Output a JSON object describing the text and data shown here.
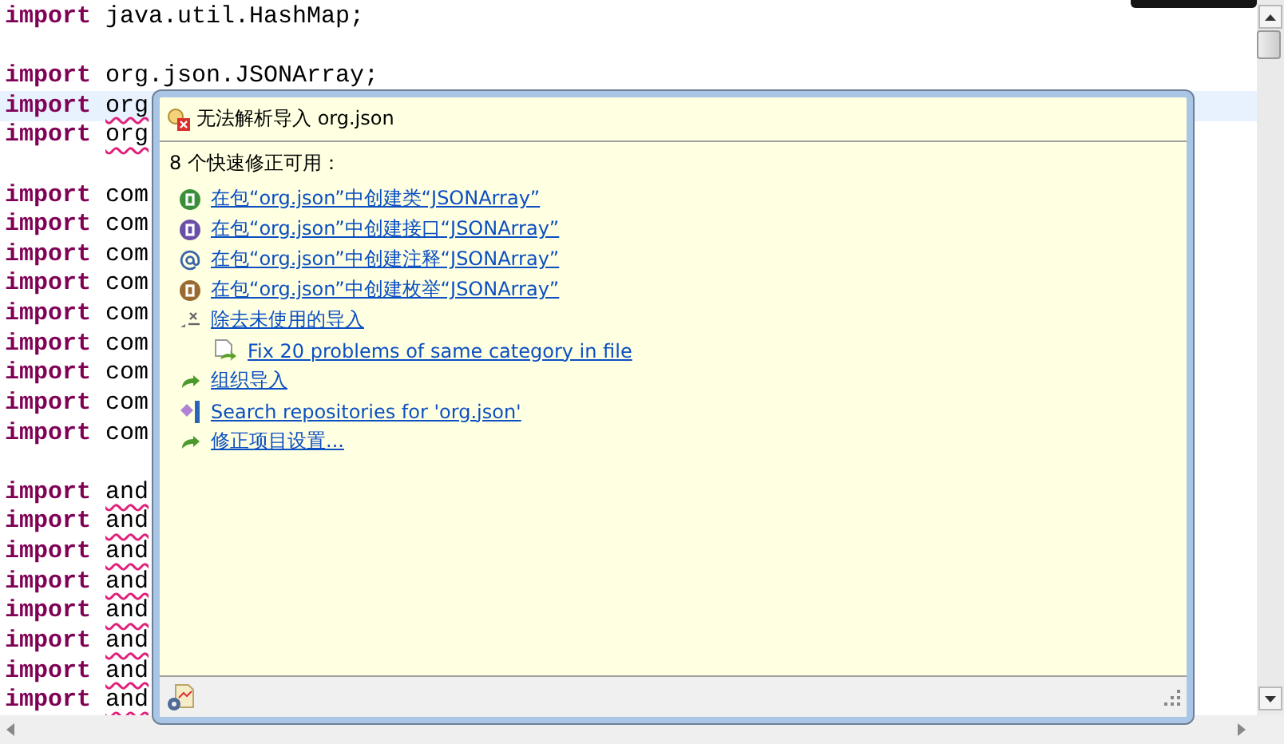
{
  "editor": {
    "lines": [
      {
        "kind": "import",
        "keyword": "import",
        "text": "java.util.HashMap;",
        "error": false,
        "current": false
      },
      {
        "kind": "blank"
      },
      {
        "kind": "import",
        "keyword": "import",
        "text": "org.json.JSONArray;",
        "error": false,
        "current": false
      },
      {
        "kind": "import",
        "keyword": "import",
        "text": "org",
        "error": true,
        "current": true
      },
      {
        "kind": "import",
        "keyword": "import",
        "text": "org",
        "error": true,
        "current": false
      },
      {
        "kind": "blank"
      },
      {
        "kind": "import",
        "keyword": "import",
        "text": "com",
        "error": false,
        "current": false
      },
      {
        "kind": "import",
        "keyword": "import",
        "text": "com",
        "error": false,
        "current": false
      },
      {
        "kind": "import",
        "keyword": "import",
        "text": "com",
        "error": false,
        "current": false
      },
      {
        "kind": "import",
        "keyword": "import",
        "text": "com",
        "error": false,
        "current": false
      },
      {
        "kind": "import",
        "keyword": "import",
        "text": "com",
        "error": false,
        "current": false
      },
      {
        "kind": "import",
        "keyword": "import",
        "text": "com",
        "error": false,
        "current": false
      },
      {
        "kind": "import",
        "keyword": "import",
        "text": "com",
        "error": false,
        "current": false
      },
      {
        "kind": "import",
        "keyword": "import",
        "text": "com",
        "error": false,
        "current": false
      },
      {
        "kind": "import",
        "keyword": "import",
        "text": "com",
        "error": false,
        "current": false
      },
      {
        "kind": "blank"
      },
      {
        "kind": "import",
        "keyword": "import",
        "text": "and",
        "error": true,
        "current": false
      },
      {
        "kind": "import",
        "keyword": "import",
        "text": "and",
        "error": true,
        "current": false
      },
      {
        "kind": "import",
        "keyword": "import",
        "text": "and",
        "error": true,
        "current": false
      },
      {
        "kind": "import",
        "keyword": "import",
        "text": "and",
        "error": true,
        "current": false
      },
      {
        "kind": "import",
        "keyword": "import",
        "text": "and",
        "error": true,
        "current": false
      },
      {
        "kind": "import",
        "keyword": "import",
        "text": "and",
        "error": true,
        "current": false
      },
      {
        "kind": "import",
        "keyword": "import",
        "text": "and",
        "error": true,
        "current": false
      },
      {
        "kind": "import",
        "keyword": "import",
        "text": "and",
        "error": true,
        "current": false
      }
    ]
  },
  "quick_fix": {
    "title": "无法解析导入 org.json",
    "heading": "8 个快速修正可用：",
    "fixes": [
      {
        "kind": "class",
        "label": "在包“org.json”中创建类“JSONArray”"
      },
      {
        "kind": "interface",
        "label": "在包“org.json”中创建接口“JSONArray”"
      },
      {
        "kind": "annotation",
        "label": "在包“org.json”中创建注释“JSONArray”"
      },
      {
        "kind": "enum",
        "label": "在包“org.json”中创建枚举“JSONArray”"
      },
      {
        "kind": "remove",
        "label": "除去未使用的导入",
        "children": [
          {
            "kind": "fix-file",
            "label": "Fix 20 problems of same category in file"
          }
        ]
      },
      {
        "kind": "change",
        "label": "组织导入"
      },
      {
        "kind": "search",
        "label": "Search repositories for 'org.json'"
      },
      {
        "kind": "change",
        "label": "修正项目设置..."
      }
    ]
  }
}
